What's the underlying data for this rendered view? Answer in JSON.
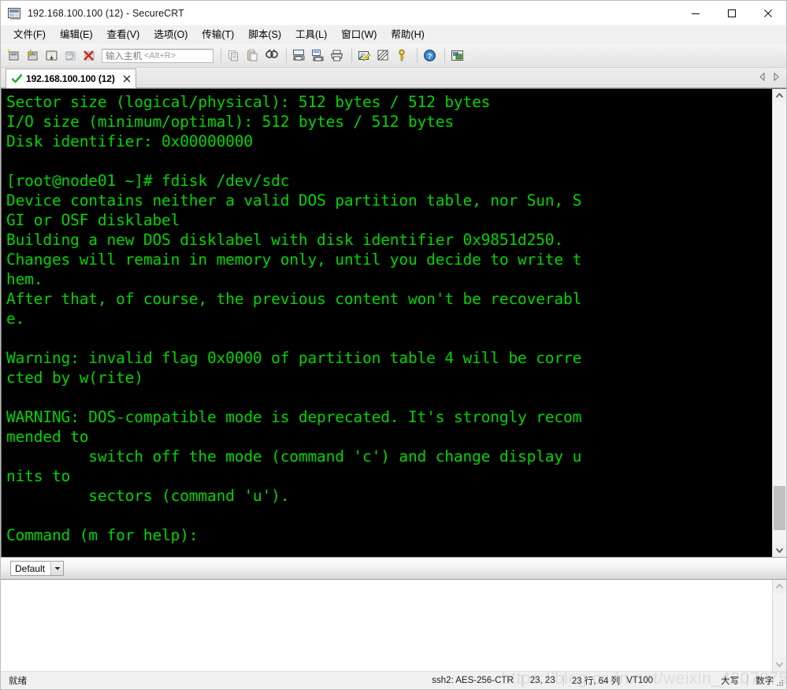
{
  "window": {
    "title": "192.168.100.100 (12) - SecureCRT",
    "app_icon": "securecrt-icon",
    "minimize_label": "—",
    "maximize_label": "□",
    "close_label": "✕"
  },
  "menubar": {
    "items": [
      {
        "label": "文件(F)",
        "name": "menu-file"
      },
      {
        "label": "编辑(E)",
        "name": "menu-edit"
      },
      {
        "label": "查看(V)",
        "name": "menu-view"
      },
      {
        "label": "选项(O)",
        "name": "menu-options"
      },
      {
        "label": "传输(T)",
        "name": "menu-transfer"
      },
      {
        "label": "脚本(S)",
        "name": "menu-script"
      },
      {
        "label": "工具(L)",
        "name": "menu-tools"
      },
      {
        "label": "窗口(W)",
        "name": "menu-window"
      },
      {
        "label": "帮助(H)",
        "name": "menu-help"
      }
    ]
  },
  "toolbar": {
    "host_placeholder_cjk": "输入主机",
    "host_placeholder_key": "<Alt+R>",
    "host_value": "",
    "icons": [
      "new-session-icon",
      "connect-session-icon",
      "connect-local-shell-icon",
      "reconnect-icon",
      "disconnect-icon",
      "copy-icon",
      "paste-icon",
      "find-icon",
      "log-session-icon",
      "print-screen-icon",
      "print-icon",
      "session-options-icon",
      "toggle-chat-icon",
      "key-icon",
      "help-icon",
      "tile-windows-icon"
    ]
  },
  "tabs": {
    "items": [
      {
        "label": "192.168.100.100 (12)",
        "status_icon": "connected-check-icon",
        "close_icon": "close-icon",
        "active": true
      }
    ],
    "nav_prev_icon": "chevron-left-icon",
    "nav_next_icon": "chevron-right-icon"
  },
  "terminal": {
    "fg_color": "#00d500",
    "bg_color": "#000000",
    "lines": [
      "Sector size (logical/physical): 512 bytes / 512 bytes",
      "I/O size (minimum/optimal): 512 bytes / 512 bytes",
      "Disk identifier: 0x00000000",
      "",
      "[root@node01 ~]# fdisk /dev/sdc",
      "Device contains neither a valid DOS partition table, nor Sun, S",
      "GI or OSF disklabel",
      "Building a new DOS disklabel with disk identifier 0x9851d250.",
      "Changes will remain in memory only, until you decide to write t",
      "hem.",
      "After that, of course, the previous content won't be recoverabl",
      "e.",
      "",
      "Warning: invalid flag 0x0000 of partition table 4 will be corre",
      "cted by w(rite)",
      "",
      "WARNING: DOS-compatible mode is deprecated. It's strongly recom",
      "mended to",
      "         switch off the mode (command 'c') and change display u",
      "nits to",
      "         sectors (command 'u').",
      "",
      "Command (m for help): "
    ],
    "scrollbar": {
      "up_icon": "scroll-up-icon",
      "down_icon": "scroll-down-icon",
      "thumb_top_pct": 87,
      "thumb_height_pct": 10
    }
  },
  "session_bar": {
    "selected": "Default",
    "dropdown_icon": "chevron-down-icon"
  },
  "lower_pane": {
    "content": "",
    "scrollbar": {
      "up_icon": "scroll-up-icon",
      "down_icon": "scroll-down-icon"
    }
  },
  "statusbar": {
    "ready": "就绪",
    "protocol": "ssh2: AES-256-CTR",
    "cursor_pos": "23, 23",
    "dimensions": "23 行, 64 列",
    "emulation": "VT100",
    "caps": "大写",
    "num": "数字",
    "resize_grip_icon": "resize-grip-icon"
  },
  "watermark": {
    "text": "https://blog.csdn.net/weixin_42072754"
  }
}
